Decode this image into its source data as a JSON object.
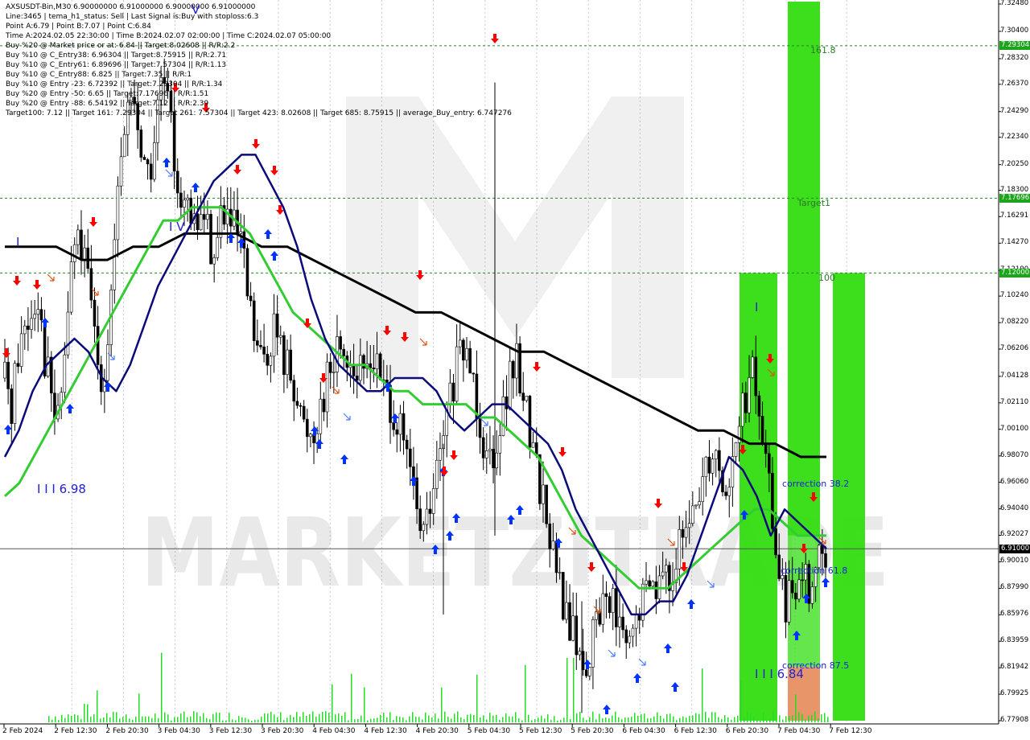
{
  "header": {
    "lines": [
      "AXSUSDT-Bin,M30  6.90000000 6.91000000 6.90000000 6.91000000",
      "Line:3465  |  tema_h1_status: Sell  |  Last Signal is:Buy with stoploss:6.3",
      "Point A:6.79  |  Point B:7.07  |  Point C:6.84",
      "Time A:2024.02.05 22:30:00  |  Time B:2024.02.07 02:00:00  |  Time C:2024.02.07 05:00:00",
      "Buy %20 @ Market price or at: 6.84  ||  Target:8.02608  ||  R/R:2.2",
      "Buy %10 @ C_Entry38: 6.96304  ||  Target:8.75915  ||  R/R:2.71",
      "Buy %10 @ C_Entry61: 6.89696  ||  Target:7.57304  ||  R/R:1.13",
      "Buy %10 @ C_Entry88: 6.825  ||  Target:7.35  ||  R/R:1",
      "Buy %10 @ Entry -23: 6.72392  ||  Target:7.29304  ||  R/R:1.34",
      "Buy %20 @ Entry -50: 6.65  ||  Target:7.17696  ||  R/R:1.51",
      "Buy %20 @ Entry -88: 6.54192  ||  Target:7.12  ||  R/R:2.39",
      "Target100: 7.12  ||  Target 161: 7.29304  ||  Target 261: 7.57304  ||  Target 423: 8.02608  ||  Target 685: 8.75915  ||  average_Buy_entry: 6.747276"
    ]
  },
  "watermark": "MARKETZITRADE",
  "price_labels": [
    "7.32480",
    "7.30400",
    "7.28320",
    "7.26370",
    "7.24290",
    "7.22340",
    "7.20250",
    "7.18300",
    "7.16291",
    "7.14270",
    "7.12190",
    "7.10240",
    "7.08220",
    "7.06206",
    "7.04128",
    "7.02110",
    "7.00100",
    "6.98070",
    "6.96060",
    "6.94040",
    "6.92027",
    "6.90010",
    "6.87990",
    "6.85976",
    "6.83959",
    "6.81942",
    "6.79925",
    "6.77908"
  ],
  "badges": [
    {
      "label": "7.29304",
      "color": "#1aa51a"
    },
    {
      "label": "7.17696",
      "color": "#1aa51a"
    },
    {
      "label": "7.12000",
      "color": "#1aa51a"
    },
    {
      "label": "6.91000",
      "color": "#000000"
    }
  ],
  "time_labels": [
    "2 Feb 2024",
    "2 Feb 12:30",
    "2 Feb 20:30",
    "3 Feb 04:30",
    "3 Feb 12:30",
    "3 Feb 20:30",
    "4 Feb 04:30",
    "4 Feb 12:30",
    "4 Feb 20:30",
    "5 Feb 04:30",
    "5 Feb 12:30",
    "5 Feb 20:30",
    "6 Feb 04:30",
    "6 Feb 12:30",
    "6 Feb 20:30",
    "7 Feb 04:30",
    "7 Feb 12:30"
  ],
  "annotations": {
    "fib_161": "161.8",
    "target1": "Target1",
    "fib_100": "100",
    "corr_38": "correction 38.2",
    "corr_61": "correction 61.8",
    "corr_87": "correction 87.5",
    "wave_iv": "I V",
    "wave_i": "I",
    "wave_i_top": "I",
    "wave_v_top": "V",
    "wave_iii_low": "I I I 6.98",
    "wave_iii_now": "I I I 6.84"
  },
  "colors": {
    "up_candle": "#000000",
    "down_candle": "#000000",
    "ma_fast": "#0a0a7a",
    "ma_mid": "#33cc33",
    "ma_slow": "#000000",
    "buy_arrow": "#0033ff",
    "sell_arrow": "#ff0000",
    "zone_green": "#33dd11",
    "zone_orange": "#e8956a",
    "fib_line": "#228822",
    "volume": "#22dd22"
  },
  "chart_data": {
    "type": "candlestick",
    "symbol": "AXSUSDT-Bin",
    "timeframe": "M30",
    "ylim": [
      6.77908,
      7.3248
    ],
    "x_start": "2 Feb 2024",
    "x_end": "7 Feb 12:30",
    "close_path": [
      7.04,
      7.02,
      7.06,
      7.08,
      7.09,
      7.11,
      7.06,
      7.03,
      7.0,
      7.05,
      7.12,
      7.15,
      7.13,
      7.1,
      7.06,
      7.04,
      7.09,
      7.16,
      7.22,
      7.26,
      7.24,
      7.21,
      7.19,
      7.23,
      7.27,
      7.24,
      7.2,
      7.18,
      7.16,
      7.15,
      7.17,
      7.15,
      7.13,
      7.17,
      7.16,
      7.15,
      7.14,
      7.1,
      7.07,
      7.05,
      7.06,
      7.08,
      7.06,
      7.05,
      7.04,
      7.01,
      7.0,
      7.0,
      7.02,
      7.04,
      7.05,
      7.07,
      7.06,
      7.05,
      7.04,
      7.05,
      7.06,
      7.04,
      7.03,
      7.02,
      7.0,
      6.98,
      6.96,
      6.93,
      6.92,
      6.95,
      6.97,
      7.0,
      7.03,
      7.05,
      7.06,
      7.05,
      7.02,
      6.99,
      6.98,
      7.0,
      7.02,
      7.04,
      7.05,
      7.03,
      7.0,
      6.97,
      6.95,
      6.92,
      6.89,
      6.87,
      6.85,
      6.84,
      6.82,
      6.83,
      6.85,
      6.87,
      6.88,
      6.86,
      6.84,
      6.83,
      6.85,
      6.87,
      6.88,
      6.89,
      6.88,
      6.89,
      6.9,
      6.91,
      6.92,
      6.94,
      6.96,
      6.98,
      6.99,
      6.97,
      6.95,
      6.98,
      7.01,
      7.03,
      7.04,
      7.01,
      6.97,
      6.93,
      6.89,
      6.86,
      6.88,
      6.9,
      6.89,
      6.88,
      6.9,
      6.91
    ],
    "ma_fast": [
      6.98,
      7.0,
      7.03,
      7.05,
      7.06,
      7.07,
      7.06,
      7.04,
      7.03,
      7.05,
      7.08,
      7.11,
      7.13,
      7.15,
      7.17,
      7.19,
      7.2,
      7.21,
      7.21,
      7.19,
      7.17,
      7.14,
      7.1,
      7.07,
      7.05,
      7.04,
      7.03,
      7.03,
      7.04,
      7.04,
      7.04,
      7.03,
      7.01,
      7.0,
      7.01,
      7.02,
      7.02,
      7.01,
      7.0,
      6.99,
      6.97,
      6.94,
      6.92,
      6.9,
      6.88,
      6.86,
      6.86,
      6.87,
      6.87,
      6.89,
      6.92,
      6.95,
      6.98,
      6.97,
      6.95,
      6.92,
      6.94,
      6.93,
      6.92,
      6.91
    ],
    "ma_mid": [
      6.95,
      6.96,
      6.98,
      7.0,
      7.02,
      7.04,
      7.06,
      7.08,
      7.1,
      7.12,
      7.14,
      7.16,
      7.16,
      7.17,
      7.17,
      7.17,
      7.16,
      7.15,
      7.13,
      7.11,
      7.09,
      7.08,
      7.07,
      7.06,
      7.05,
      7.05,
      7.04,
      7.03,
      7.03,
      7.02,
      7.02,
      7.02,
      7.02,
      7.01,
      7.01,
      7.0,
      6.99,
      6.98,
      6.96,
      6.94,
      6.92,
      6.91,
      6.9,
      6.89,
      6.88,
      6.88,
      6.88,
      6.89,
      6.9,
      6.91,
      6.92,
      6.93,
      6.94,
      6.94,
      6.93,
      6.92,
      6.92,
      6.92
    ],
    "ma_slow": [
      7.14,
      7.14,
      7.14,
      7.13,
      7.13,
      7.14,
      7.14,
      7.15,
      7.15,
      7.15,
      7.14,
      7.14,
      7.13,
      7.12,
      7.11,
      7.1,
      7.09,
      7.09,
      7.08,
      7.07,
      7.06,
      7.06,
      7.05,
      7.04,
      7.03,
      7.02,
      7.01,
      7.0,
      7.0,
      6.99,
      6.99,
      6.98,
      6.98
    ]
  }
}
